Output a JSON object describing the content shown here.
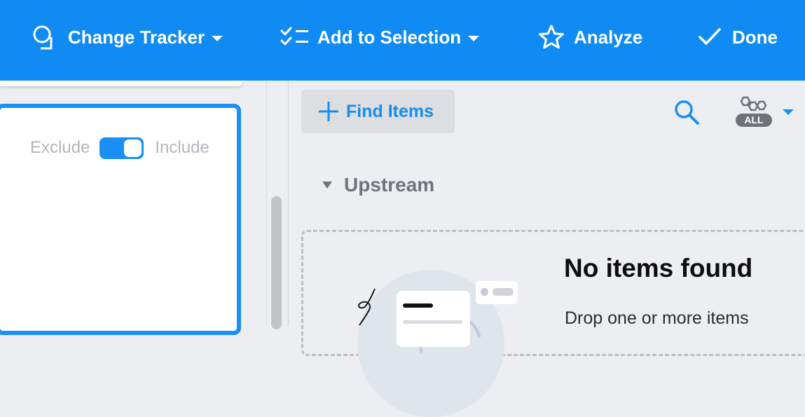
{
  "toolbar": {
    "change_tracker": "Change Tracker",
    "add_to_selection": "Add to Selection",
    "analyze": "Analyze",
    "done": "Done"
  },
  "filter": {
    "exclude_label": "Exclude",
    "include_label": "Include",
    "toggle_state": "include"
  },
  "results": {
    "find_items": "Find Items",
    "scope_badge": "ALL",
    "section_title": "Upstream",
    "empty_title": "No items found",
    "empty_text": "Drop one or more items"
  },
  "colors": {
    "accent": "#0f8bf3",
    "panel_bg": "#eceef1"
  },
  "icons": [
    "change-tracker-icon",
    "checklist-icon",
    "star-icon",
    "check-icon",
    "plus-icon",
    "search-icon",
    "hexagons-icon",
    "chevron-down-icon"
  ]
}
